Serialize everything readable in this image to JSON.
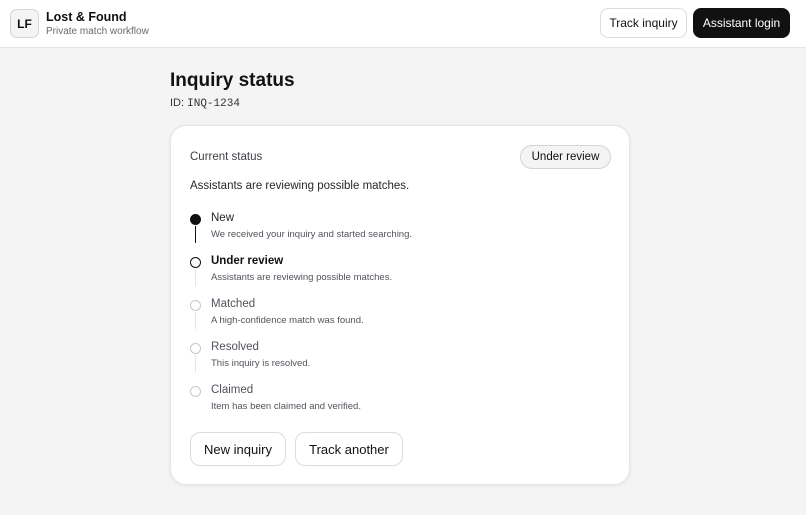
{
  "header": {
    "logo_text": "LF",
    "brand_title": "Lost & Found",
    "brand_subtitle": "Private match workflow",
    "track_inquiry_label": "Track inquiry",
    "assistant_login_label": "Assistant login"
  },
  "inquiry": {
    "title": "Inquiry status",
    "id_prefix": "ID: ",
    "id_value": "INQ-1234"
  },
  "status_card": {
    "current_status_label": "Current status",
    "badge": "Under review",
    "description": "Assistants are reviewing possible matches.",
    "steps": [
      {
        "label": "New",
        "desc": "We received your inquiry and started searching.",
        "state": "done"
      },
      {
        "label": "Under review",
        "desc": "Assistants are reviewing possible matches.",
        "state": "current"
      },
      {
        "label": "Matched",
        "desc": "A high-confidence match was found.",
        "state": "future"
      },
      {
        "label": "Resolved",
        "desc": "This inquiry is resolved.",
        "state": "future"
      },
      {
        "label": "Claimed",
        "desc": "Item has been claimed and verified.",
        "state": "future"
      }
    ],
    "new_inquiry_label": "New inquiry",
    "track_another_label": "Track another"
  },
  "colors": {
    "primary": "#111111",
    "background": "#f4f4f5",
    "border": "#e4e4e7"
  }
}
